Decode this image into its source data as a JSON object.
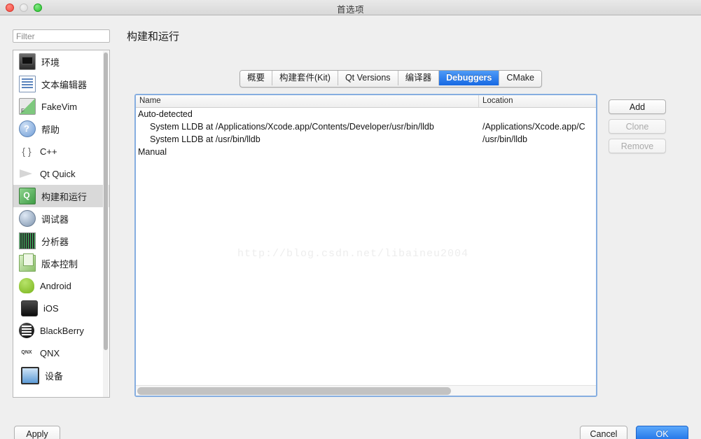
{
  "window": {
    "title": "首选项",
    "traffic_lights": [
      "close-light",
      "minimize-light",
      "zoom-light"
    ]
  },
  "search": {
    "placeholder": "Filter",
    "value": ""
  },
  "sidebar": {
    "items": [
      {
        "label": "环境",
        "icon": "environment-icon",
        "selected": false
      },
      {
        "label": "文本编辑器",
        "icon": "text-editor-icon",
        "selected": false
      },
      {
        "label": "FakeVim",
        "icon": "fakevim-icon",
        "selected": false
      },
      {
        "label": "帮助",
        "icon": "help-icon",
        "selected": false
      },
      {
        "label": "C++",
        "icon": "cpp-icon",
        "selected": false
      },
      {
        "label": "Qt Quick",
        "icon": "qt-quick-icon",
        "selected": false
      },
      {
        "label": "构建和运行",
        "icon": "build-and-run-icon",
        "selected": true
      },
      {
        "label": "调试器",
        "icon": "debugger-icon",
        "selected": false
      },
      {
        "label": "分析器",
        "icon": "analyzer-icon",
        "selected": false
      },
      {
        "label": "版本控制",
        "icon": "version-control-icon",
        "selected": false
      },
      {
        "label": "Android",
        "icon": "android-icon",
        "selected": false
      },
      {
        "label": "iOS",
        "icon": "ios-icon",
        "selected": false
      },
      {
        "label": "BlackBerry",
        "icon": "blackberry-icon",
        "selected": false
      },
      {
        "label": "QNX",
        "icon": "qnx-icon",
        "selected": false
      },
      {
        "label": "设备",
        "icon": "device-icon",
        "selected": false
      }
    ]
  },
  "page": {
    "title": "构建和运行"
  },
  "tabs": [
    {
      "label": "概要",
      "active": false
    },
    {
      "label": "构建套件(Kit)",
      "active": false
    },
    {
      "label": "Qt Versions",
      "active": false
    },
    {
      "label": "编译器",
      "active": false
    },
    {
      "label": "Debuggers",
      "active": true
    },
    {
      "label": "CMake",
      "active": false
    }
  ],
  "table": {
    "columns": [
      "Name",
      "Location"
    ],
    "rows": [
      {
        "name": "Auto-detected",
        "location": "",
        "child": false
      },
      {
        "name": "System LLDB at /Applications/Xcode.app/Contents/Developer/usr/bin/lldb",
        "location": "/Applications/Xcode.app/C",
        "child": true
      },
      {
        "name": "System LLDB at /usr/bin/lldb",
        "location": "/usr/bin/lldb",
        "child": true
      },
      {
        "name": "Manual",
        "location": "",
        "child": false
      }
    ]
  },
  "watermark": {
    "text": "http://blog.csdn.net/libaineu2004"
  },
  "side_buttons": [
    {
      "label": "Add",
      "enabled": true
    },
    {
      "label": "Clone",
      "enabled": false
    },
    {
      "label": "Remove",
      "enabled": false
    }
  ],
  "footer": {
    "apply_label": "Apply",
    "cancel_label": "Cancel",
    "ok_label": "OK"
  },
  "colors": {
    "accent_blue": "#1668e3",
    "focus_border": "#86aee0",
    "selection_gray": "#d9d9d9"
  }
}
